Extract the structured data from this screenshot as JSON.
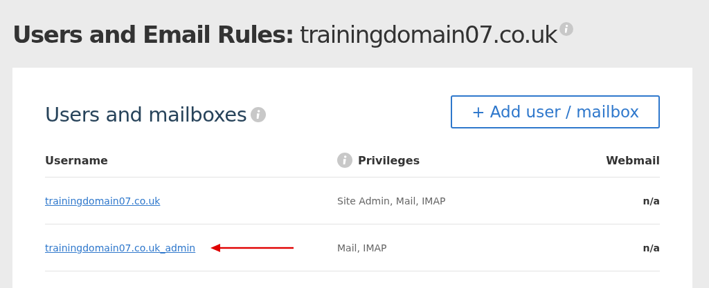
{
  "page_title": "**Users and Email Rules:** trainingdomain07.co.uk",
  "section": {
    "title": "Users and mailboxes",
    "add_button": "+ Add user / mailbox"
  },
  "table": {
    "columns": [
      "Username",
      "Privileges",
      "Webmail"
    ],
    "rows": [
      {
        "username": "trainingdomain07.co.uk",
        "privileges": "Site Admin, Mail, IMAP",
        "webmail": "n/a",
        "pointer_arrow": false
      },
      {
        "username": "trainingdomain07.co.uk_admin",
        "privileges": "Mail, IMAP",
        "webmail": "n/a",
        "pointer_arrow": true
      }
    ]
  }
}
